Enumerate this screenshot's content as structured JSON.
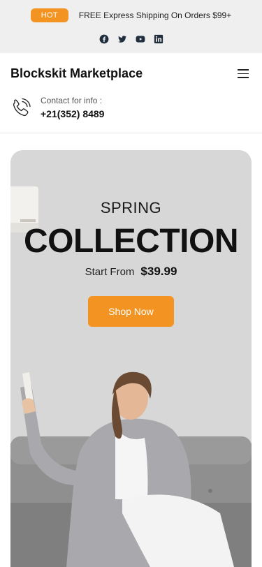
{
  "promo": {
    "badge": "HOT",
    "text": "FREE Express Shipping On Orders $99+"
  },
  "social": [
    {
      "icon": "facebook-icon"
    },
    {
      "icon": "twitter-icon"
    },
    {
      "icon": "youtube-icon"
    },
    {
      "icon": "linkedin-icon"
    }
  ],
  "header": {
    "brand": "Blockskit Marketplace",
    "menu_icon": "hamburger-menu-icon",
    "contact_label": "Contact for info :",
    "contact_phone": "+21(352) 8489",
    "phone_icon": "phone-icon"
  },
  "hero": {
    "subtitle": "SPRING",
    "title": "COLLECTION",
    "price_label": "Start From",
    "price_value": "$39.99",
    "button_label": "Shop Now"
  },
  "colors": {
    "accent": "#f39322",
    "topbar_bg": "#efefef",
    "text_dark": "#111111"
  }
}
